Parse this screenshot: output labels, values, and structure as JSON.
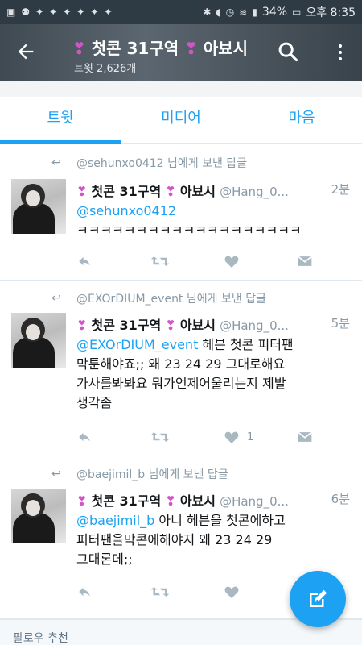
{
  "status_bar": {
    "battery": "34%",
    "time": "오후 8:35"
  },
  "header": {
    "heart_left": "❣",
    "title_text": "첫콘 31구역",
    "heart_right": "❣",
    "title_tail": "아뵤시",
    "tweet_count": "트윗 2,626개"
  },
  "tabs": [
    {
      "label": "트윗",
      "active": true
    },
    {
      "label": "미디어",
      "active": false
    },
    {
      "label": "마음",
      "active": false
    }
  ],
  "tweets": [
    {
      "reply_handle": "@sehunxo0412",
      "reply_suffix": " 님에게 보낸 답글",
      "name_part1": "첫콘 31구역",
      "name_part2": "아뵤시",
      "username": "@Hang_0...",
      "time": "2분",
      "mention": "@sehunxo0412",
      "text_line1": "",
      "text_rest": "ㅋㅋㅋㅋㅋㅋㅋㅋㅋㅋㅋㅋㅋㅋㅋㅋㅋㅋㅋ",
      "like_count": ""
    },
    {
      "reply_handle": "@EXOrDIUM_event",
      "reply_suffix": " 님에게 보낸 답글",
      "name_part1": "첫콘 31구역",
      "name_part2": "아뵤시",
      "username": "@Hang_0...",
      "time": "5분",
      "mention": "@EXOrDIUM_event",
      "text_line1": " 헤븐 첫콘 피터팬",
      "text_rest": "막툰해야죠;; 왜 23 24 29 그대로해요\n가사를봐봐요 뭐가언제어울리는지 제발\n생각좀",
      "like_count": "1"
    },
    {
      "reply_handle": "@baejimil_b",
      "reply_suffix": " 님에게 보낸 답글",
      "name_part1": "첫콘 31구역",
      "name_part2": "아뵤시",
      "username": "@Hang_0...",
      "time": "6분",
      "mention": "@baejimil_b",
      "text_line1": " 아니 헤븐을 첫콘에하고",
      "text_rest": "피터팬을막콘에해야지 왜 23 24 29\n그대론데;;",
      "like_count": ""
    }
  ],
  "follow_recommend": "팔로우 추천",
  "colors": {
    "accent": "#1da1f2",
    "heart": "#d255c8",
    "muted": "#8899a6"
  },
  "icons": {
    "back": "arrow-left-icon",
    "search": "search-icon",
    "more": "more-vertical-icon",
    "reply": "reply-icon",
    "retweet": "retweet-icon",
    "like": "heart-icon",
    "dm": "envelope-icon",
    "compose": "compose-icon"
  }
}
